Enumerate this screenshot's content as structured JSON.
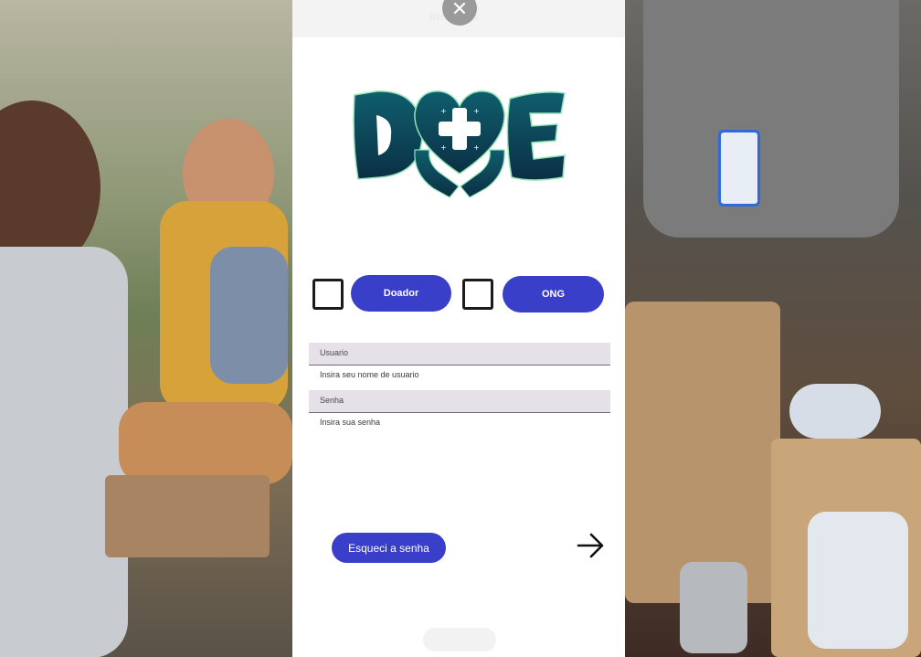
{
  "topbar": {
    "title": "Bem-vindo"
  },
  "logo": {
    "alt": "DOE"
  },
  "role_selector": {
    "option_1": {
      "label": "Doador",
      "checked": false
    },
    "option_2": {
      "label": "ONG",
      "checked": false
    }
  },
  "form": {
    "username": {
      "label": "Usuario",
      "hint": "Insira seu nome de usuario"
    },
    "password": {
      "label": "Senha",
      "hint": "Insira sua senha"
    }
  },
  "actions": {
    "forgot_label": "Esqueci a senha",
    "next_icon": "arrow-right-icon",
    "close_icon": "close-icon"
  },
  "colors": {
    "accent": "#3a3fc9",
    "logo_dark": "#0f3a4d",
    "logo_glow": "#8fe3b4",
    "field_bg": "#e6e1e8"
  }
}
